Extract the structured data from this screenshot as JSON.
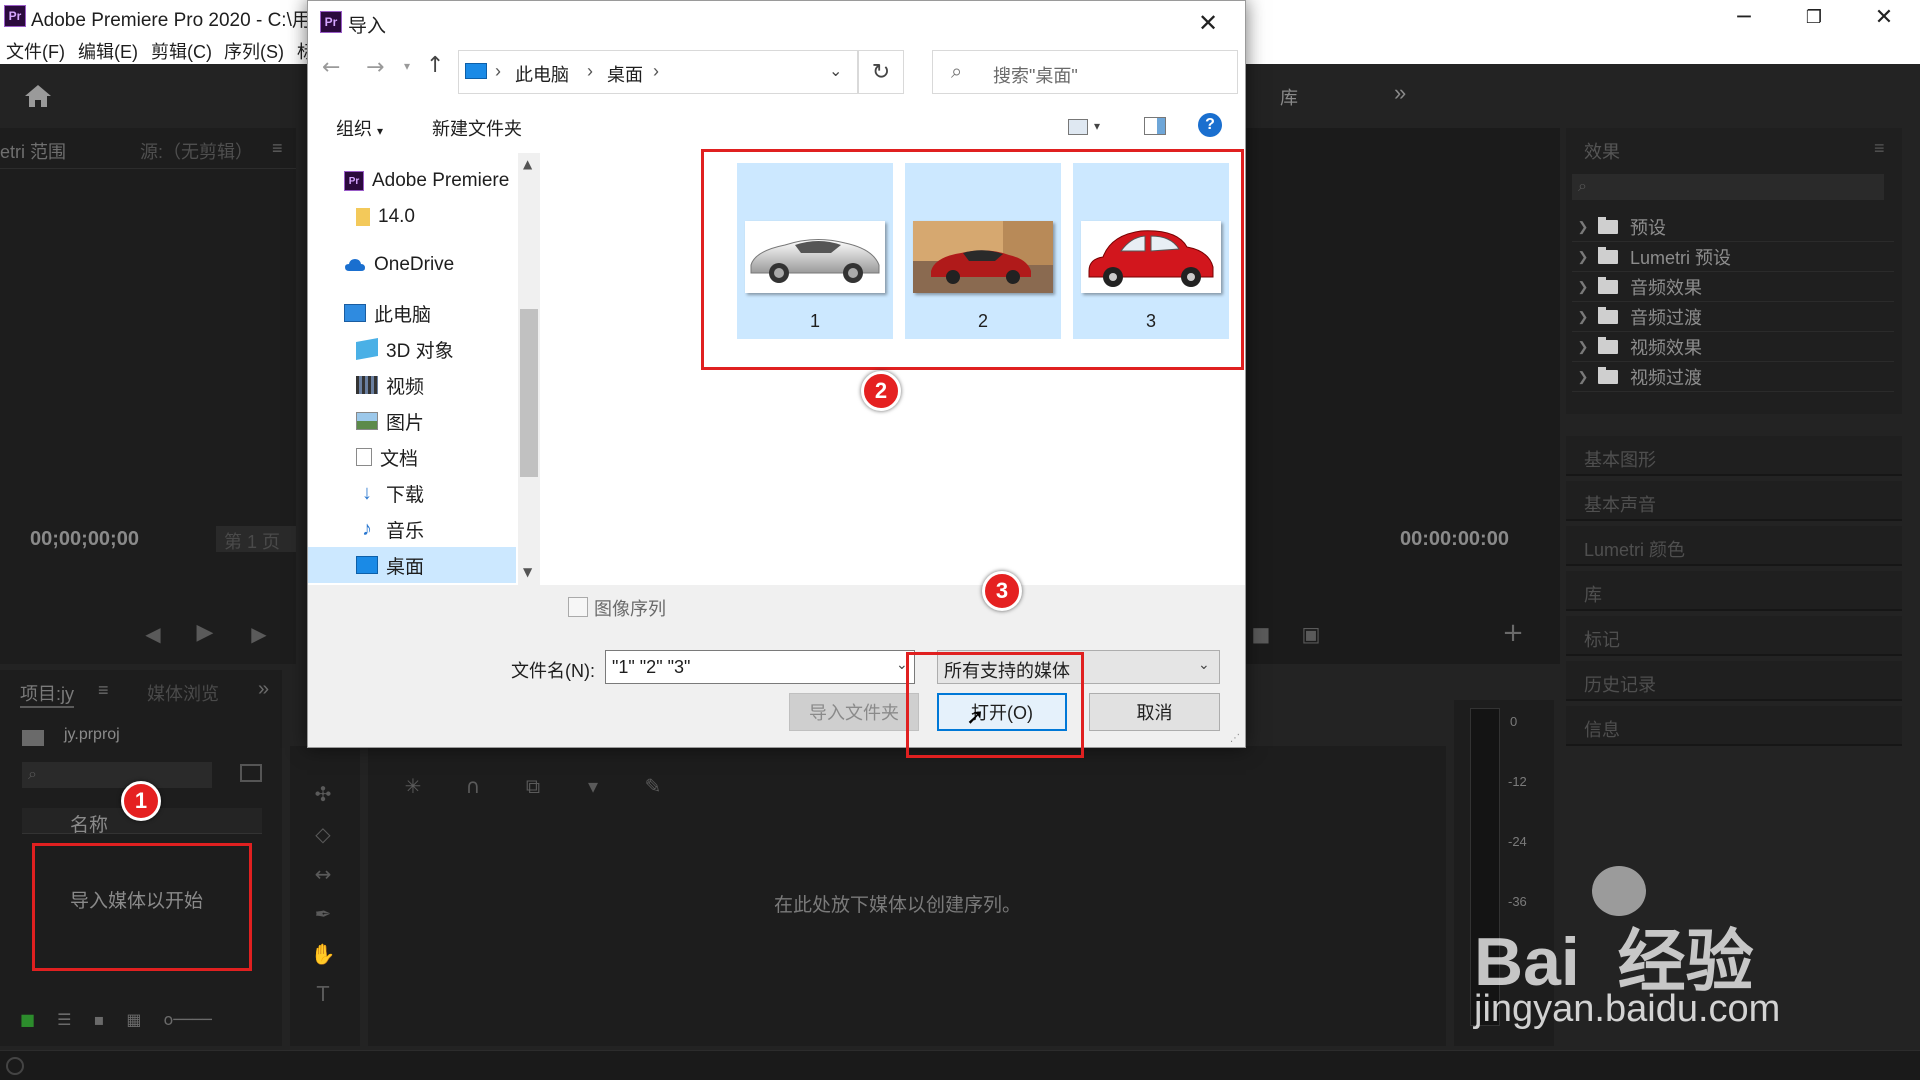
{
  "app": {
    "title": "Adobe Premiere Pro 2020 - C:\\用",
    "logo": "Pr",
    "menu": [
      "文件(F)",
      "编辑(E)",
      "剪辑(C)",
      "序列(S)",
      "标"
    ],
    "window_buttons": [
      "─",
      "❐",
      "✕"
    ]
  },
  "workspace": {
    "top_tab_library": "库",
    "more": "»"
  },
  "source_panel": {
    "tab_scopes": "etri 范围",
    "tab_source": "源:（无剪辑）",
    "timecode": "00;00;00;00",
    "page": "第 1 页"
  },
  "program_panel": {
    "timecode": "00:00:00:00"
  },
  "effects_panel": {
    "title": "效果",
    "items": [
      "预设",
      "Lumetri 预设",
      "音频效果",
      "音频过渡",
      "视频效果",
      "视频过渡"
    ],
    "sections": [
      "基本图形",
      "基本声音",
      "Lumetri 颜色",
      "库",
      "标记",
      "历史记录",
      "信息"
    ]
  },
  "project_panel": {
    "tab_project": "项目:jy",
    "tab_media": "媒体浏览",
    "file": "jy.prproj",
    "col_name": "名称",
    "empty_hint": "导入媒体以开始"
  },
  "timeline": {
    "empty_hint": "在此处放下媒体以创建序列。"
  },
  "meter": {
    "labels": [
      "0",
      "-12",
      "-24",
      "-36"
    ]
  },
  "dialog": {
    "logo": "Pr",
    "title": "导入",
    "breadcrumb": [
      "此电脑",
      "桌面"
    ],
    "search_placeholder": "搜索\"桌面\"",
    "toolbar": {
      "organize": "组织",
      "new_folder": "新建文件夹"
    },
    "nav": [
      {
        "label": "Adobe Premiere",
        "icon": "premiere-icon"
      },
      {
        "label": "14.0",
        "icon": "folder-icon"
      },
      {
        "label": "OneDrive",
        "icon": "onedrive-icon"
      },
      {
        "label": "此电脑",
        "icon": "pc-icon"
      },
      {
        "label": "3D 对象",
        "icon": "3d-objects-icon"
      },
      {
        "label": "视频",
        "icon": "video-icon"
      },
      {
        "label": "图片",
        "icon": "pictures-icon"
      },
      {
        "label": "文档",
        "icon": "documents-icon"
      },
      {
        "label": "下载",
        "icon": "download-icon"
      },
      {
        "label": "音乐",
        "icon": "music-icon"
      },
      {
        "label": "桌面",
        "icon": "desktop-icon"
      }
    ],
    "files": [
      {
        "name": "1"
      },
      {
        "name": "2"
      },
      {
        "name": "3"
      }
    ],
    "image_sequence": "图像序列",
    "filename_label": "文件名(N):",
    "filename_value": "\"1\" \"2\" \"3\"",
    "filetype": "所有支持的媒体",
    "import_folder": "导入文件夹",
    "open": "打开(O)",
    "cancel": "取消"
  },
  "annotations": [
    "1",
    "2",
    "3"
  ],
  "watermark": {
    "brand_line1": "Bai  经验",
    "brand_line2": "jingyan.baidu.com"
  },
  "colors": {
    "annotation_red": "#e02020",
    "selection_blue": "#cce8ff",
    "premiere_dark": "#232323"
  }
}
